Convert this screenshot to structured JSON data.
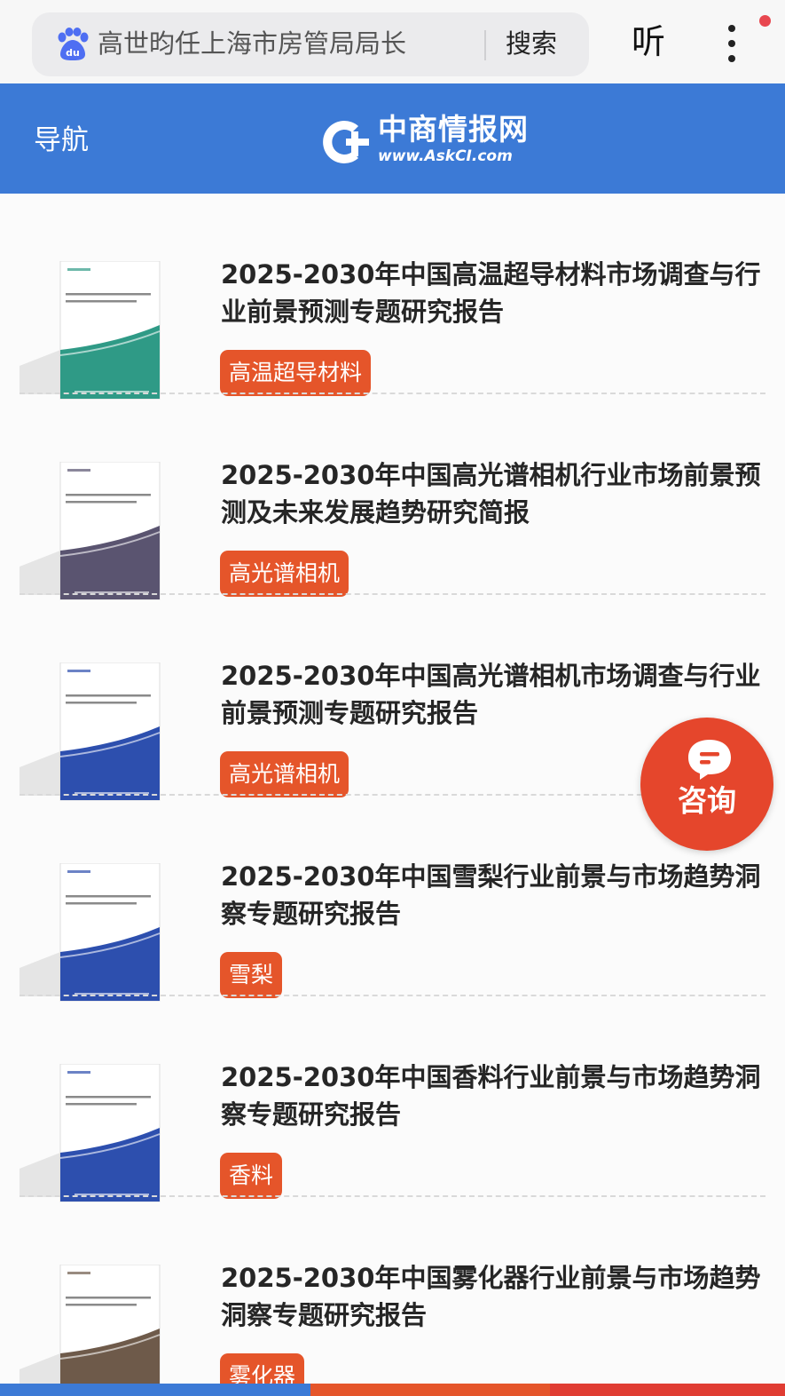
{
  "search": {
    "query": "高世昀任上海市房管局局长",
    "search_label": "搜索",
    "listen_label": "听"
  },
  "header": {
    "nav_label": "导航",
    "logo_name": "中商情报网",
    "logo_url": "www.AskCI.com"
  },
  "reports": [
    {
      "title": "2025-2030年中国高温超导材料市场调查与行业前景预测专题研究报告",
      "tag": "高温超导材料",
      "cover_color": "#2f9a86"
    },
    {
      "title": "2025-2030年中国高光谱相机行业市场前景预测及未来发展趋势研究简报",
      "tag": "高光谱相机",
      "cover_color": "#5a5470"
    },
    {
      "title": "2025-2030年中国高光谱相机市场调查与行业前景预测专题研究报告",
      "tag": "高光谱相机",
      "cover_color": "#2d4fae"
    },
    {
      "title": "2025-2030年中国雪梨行业前景与市场趋势洞察专题研究报告",
      "tag": "雪梨",
      "cover_color": "#2d4fae"
    },
    {
      "title": "2025-2030年中国香料行业前景与市场趋势洞察专题研究报告",
      "tag": "香料",
      "cover_color": "#2d4fae"
    },
    {
      "title": "2025-2030年中国雾化器行业前景与市场趋势洞察专题研究报告",
      "tag": "雾化器",
      "cover_color": "#6e5a4a"
    }
  ],
  "consult": {
    "label": "咨询"
  },
  "colors": {
    "header_bg": "#3c7ad6",
    "tag_bg": "#e5552a",
    "consult_bg": "#e5462c"
  }
}
